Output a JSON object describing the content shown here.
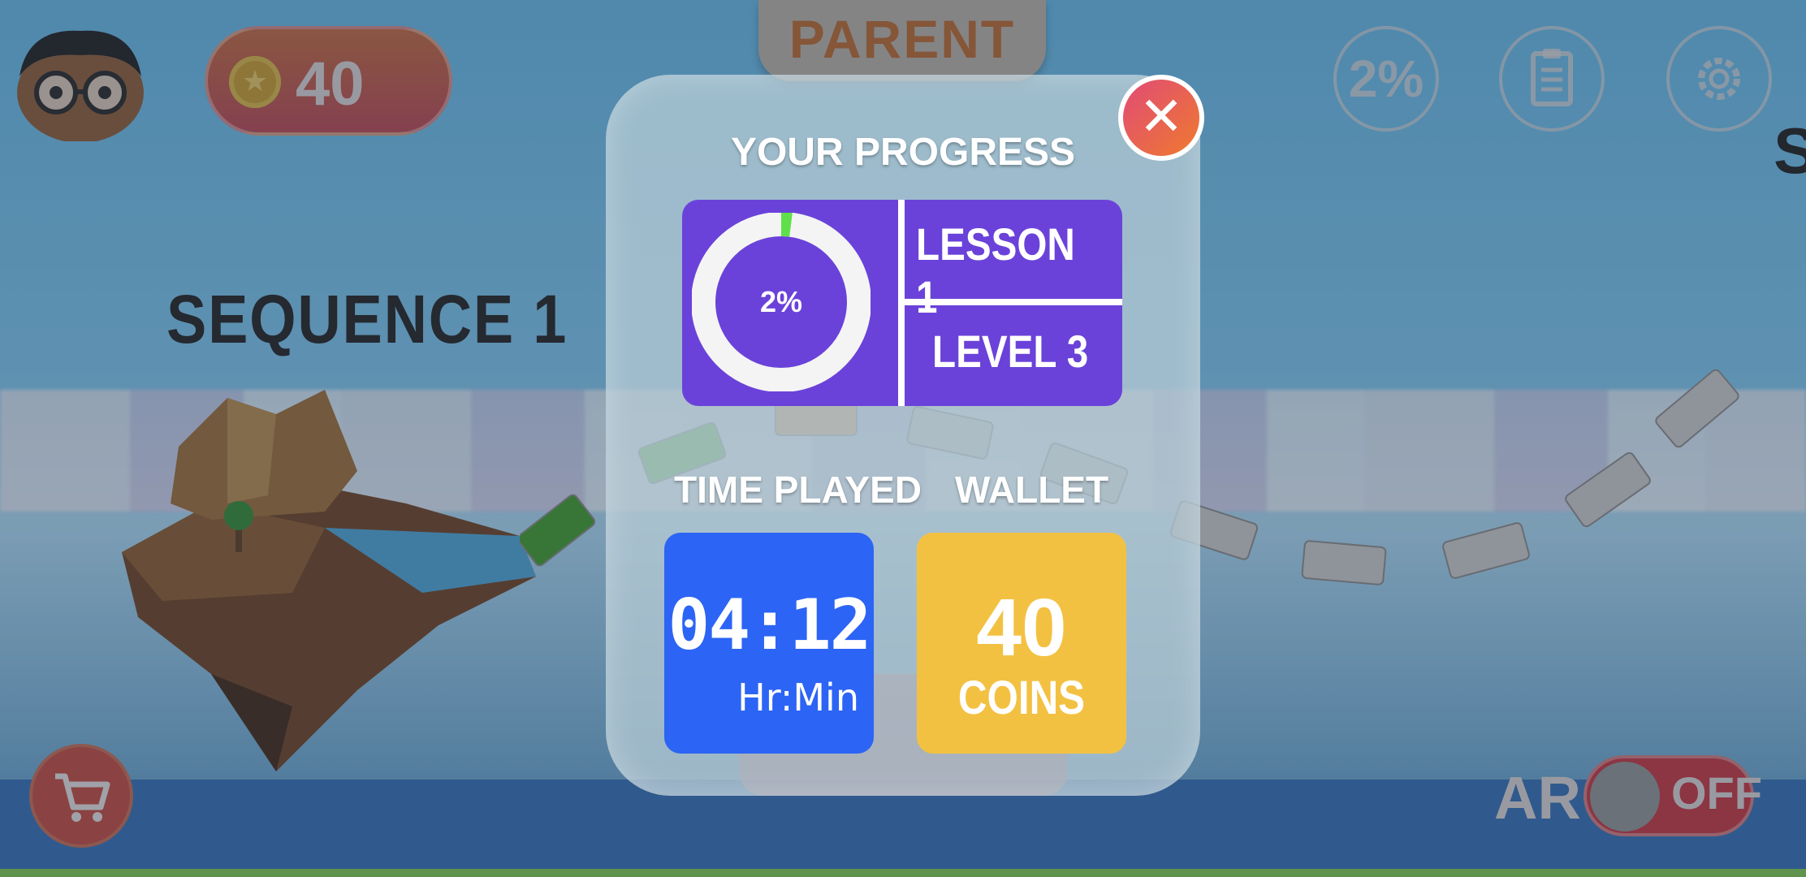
{
  "header": {
    "coins": "40",
    "parent_tab": "PARENT",
    "progress_button": "2%"
  },
  "map": {
    "sequence_title": "SEQUENCE 1",
    "side_letter": "S"
  },
  "footer": {
    "ar_label": "AR",
    "ar_toggle": "OFF"
  },
  "progress_modal": {
    "title": "YOUR PROGRESS",
    "progress_percent": "2%",
    "progress_fraction": 0.02,
    "lesson": "LESSON 1",
    "level": "LEVEL 3",
    "time_played_label": "TIME PLAYED",
    "time_played_value": "04:12",
    "time_played_unit": "Hr:Min",
    "wallet_label": "WALLET",
    "wallet_value": "40",
    "wallet_unit": "COINS"
  },
  "colors": {
    "progress_card": "#6a42d9",
    "progress_fill": "#5fe04a",
    "time_card": "#2c64f5",
    "wallet_card": "#f3c142",
    "close_button": "#e65a5a"
  },
  "icons": {
    "coin": "star-coin-icon",
    "clipboard": "clipboard-icon",
    "settings": "gear-icon",
    "cart": "shopping-cart-icon",
    "close": "close-icon"
  }
}
